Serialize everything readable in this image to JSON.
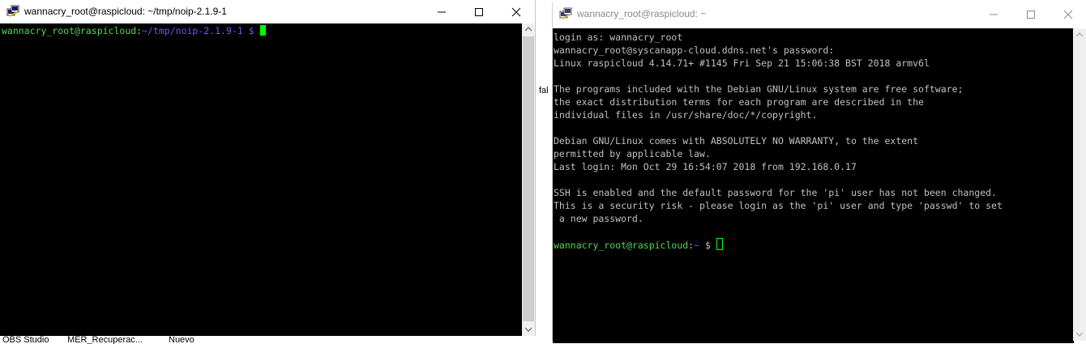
{
  "left_window": {
    "title": "wannacry_root@raspicloud: ~/tmp/noip-2.1.9-1",
    "prompt_user": "wannacry_root@raspicloud",
    "prompt_sep": ":",
    "prompt_path": "~/tmp/noip-2.1.9-1",
    "prompt_dollar": " $ ",
    "controls": {
      "minimize": "minimize",
      "maximize": "maximize",
      "close": "close"
    }
  },
  "right_window": {
    "title": "wannacry_root@raspicloud: ~",
    "lines": [
      "login as: wannacry_root",
      "wannacry_root@syscanapp-cloud.ddns.net's password:",
      "Linux raspicloud 4.14.71+ #1145 Fri Sep 21 15:06:38 BST 2018 armv6l",
      "",
      "The programs included with the Debian GNU/Linux system are free software;",
      "the exact distribution terms for each program are described in the",
      "individual files in /usr/share/doc/*/copyright.",
      "",
      "Debian GNU/Linux comes with ABSOLUTELY NO WARRANTY, to the extent",
      "permitted by applicable law.",
      "Last login: Mon Oct 29 16:54:07 2018 from 192.168.0.17",
      "",
      "SSH is enabled and the default password for the 'pi' user has not been changed.",
      "This is a security risk - please login as the 'pi' user and type 'passwd' to set",
      " a new password.",
      ""
    ],
    "prompt_user": "wannacry_root@raspicloud",
    "prompt_sep": ":",
    "prompt_path": "~",
    "prompt_dollar": " $ "
  },
  "taskbar": {
    "items": [
      "OBS Studio",
      "MER_Recuperac...",
      "Nuevo"
    ]
  },
  "background_sliver_text": "fal",
  "colors": {
    "terminal_bg": "#000000",
    "terminal_fg": "#c0c0c0",
    "prompt_user": "#55d655",
    "prompt_path": "#5f5fff",
    "cursor": "#00ff00"
  },
  "icons": {
    "putty": "putty-icon",
    "minimize": "minimize-icon",
    "maximize": "maximize-icon",
    "close": "close-icon"
  }
}
